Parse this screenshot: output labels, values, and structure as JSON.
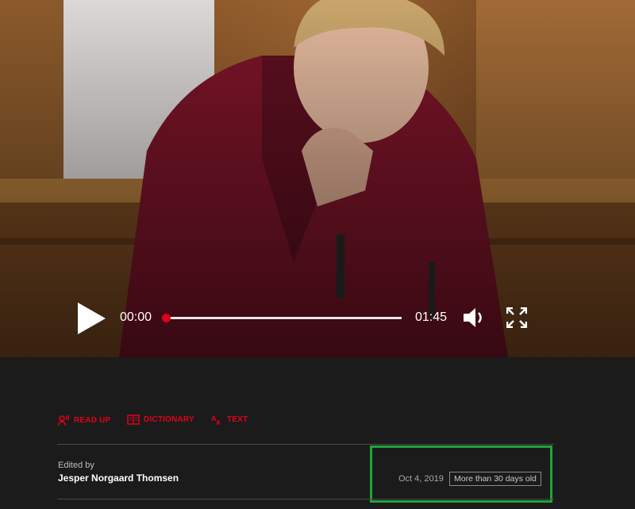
{
  "player": {
    "current_time": "00:00",
    "total_time": "01:45",
    "progress": 0
  },
  "tools": {
    "read_up": "READ UP",
    "dictionary": "DICTIONARY",
    "text": "TEXT"
  },
  "article": {
    "edited_by_label": "Edited by",
    "editor_name": "Jesper Norgaard Thomsen",
    "date": "Oct 4, 2019",
    "age_badge": "More than 30 days old"
  },
  "colors": {
    "accent": "#e2001a",
    "background": "#1b1b1b",
    "highlight": "#1fa53a"
  },
  "icons": [
    "play-icon",
    "volume-icon",
    "fullscreen-icon",
    "read-up-icon",
    "dictionary-icon",
    "text-icon"
  ]
}
